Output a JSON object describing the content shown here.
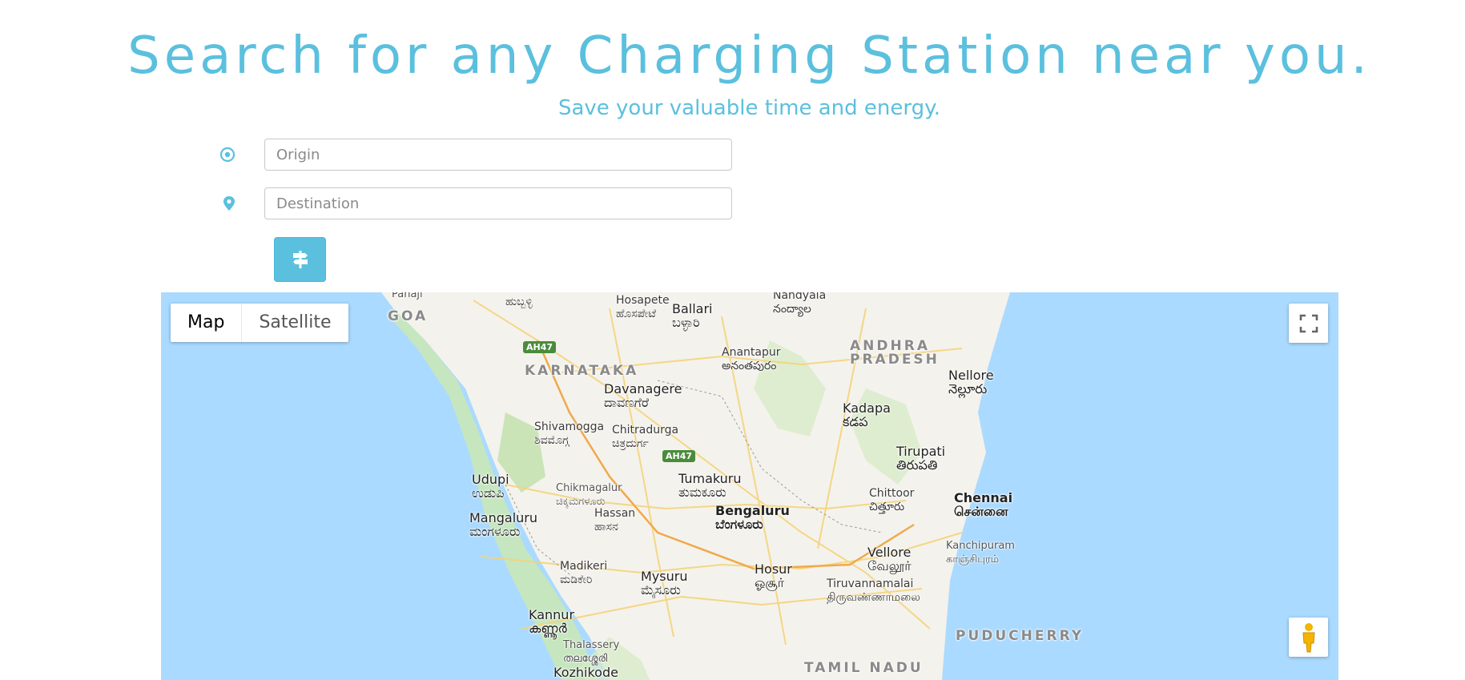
{
  "header": {
    "title": "Search for any Charging Station near you.",
    "subtitle": "Save your valuable time and energy."
  },
  "form": {
    "origin_placeholder": "Origin",
    "destination_placeholder": "Destination",
    "origin_icon": "origin-target-icon",
    "destination_icon": "map-pin-icon",
    "route_button_icon": "signpost-icon"
  },
  "map": {
    "type_controls": {
      "map_label": "Map",
      "satellite_label": "Satellite",
      "selected": "Map"
    },
    "fullscreen_icon": "fullscreen-icon",
    "pegman_icon": "pegman-icon",
    "colors": {
      "water": "#aadaff",
      "land": "#f4f2ec",
      "accent": "#5bc0de"
    },
    "labels": {
      "hubballi": "ಹುಬ್ಬಳ್ಳಿ",
      "goa": "GOA",
      "panaji": "Panaji",
      "hosapete": "Hosapete",
      "hosapete_local": "ಹೊಸಪೇಟೆ",
      "ballari": "Ballari",
      "ballari_local": "ಬಳ್ಳಾರಿ",
      "nandyala": "Nandyala",
      "nandyala_local": "నంద్యాల",
      "andhra_pradesh_1": "ANDHRA",
      "andhra_pradesh_2": "PRADESH",
      "anantapur": "Anantapur",
      "anantapur_local": "అనంతపురం",
      "karnataka": "KARNATAKA",
      "davanagere": "Davanagere",
      "davanagere_local": "ದಾವಣಗೆರೆ",
      "nellore": "Nellore",
      "nellore_local": "నెల్లూరు",
      "kadapa": "Kadapa",
      "kadapa_local": "కడప",
      "shivamogga": "Shivamogga",
      "shivamogga_local": "ಶಿವಮೊಗ್ಗ",
      "chitradurga": "Chitradurga",
      "chitradurga_local": "ಚಿತ್ರದುರ್ಗ",
      "tirupati": "Tirupati",
      "tirupati_local": "తిరుపతి",
      "udupi": "Udupi",
      "udupi_local": "ಉಡುಪಿ",
      "chikmagalur": "Chikmagalur",
      "chikmagalur_local": "ಚಿಕ್ಕಮಗಳೂರು",
      "tumakuru": "Tumakuru",
      "tumakuru_local": "ತುಮಕೂರು",
      "chittoor": "Chittoor",
      "chittoor_local": "చిత్తూరు",
      "chennai": "Chennai",
      "chennai_local": "சென்னை",
      "bengaluru": "Bengaluru",
      "bengaluru_local": "ಬೆಂಗಳೂರು",
      "mangaluru": "Mangaluru",
      "mangaluru_local": "ಮಂಗಳೂರು",
      "hassan": "Hassan",
      "hassan_local": "ಹಾಸನ",
      "kanchipuram": "Kanchipuram",
      "kanchipuram_local": "காஞ்சிபுரம்",
      "vellore": "Vellore",
      "vellore_local": "வேலூர்",
      "madikeri": "Madikeri",
      "madikeri_local": "ಮಡಿಕೇರಿ",
      "hosur": "Hosur",
      "hosur_local": "ஓசூர்",
      "mysuru": "Mysuru",
      "mysuru_local": "ಮೈಸೂರು",
      "tiruvannamalai": "Tiruvannamalai",
      "tiruvannamalai_local": "திருவண்ணாமலை",
      "kannur": "Kannur",
      "kannur_local": "കണ്ണൂർ",
      "puducherry": "PUDUCHERRY",
      "thalassery": "Thalassery",
      "thalassery_local": "തലശ്ശേരി",
      "kozhikode": "Kozhikode",
      "tamil_nadu": "TAMIL NADU",
      "ah47_a": "AH47",
      "ah47_b": "AH47"
    }
  }
}
